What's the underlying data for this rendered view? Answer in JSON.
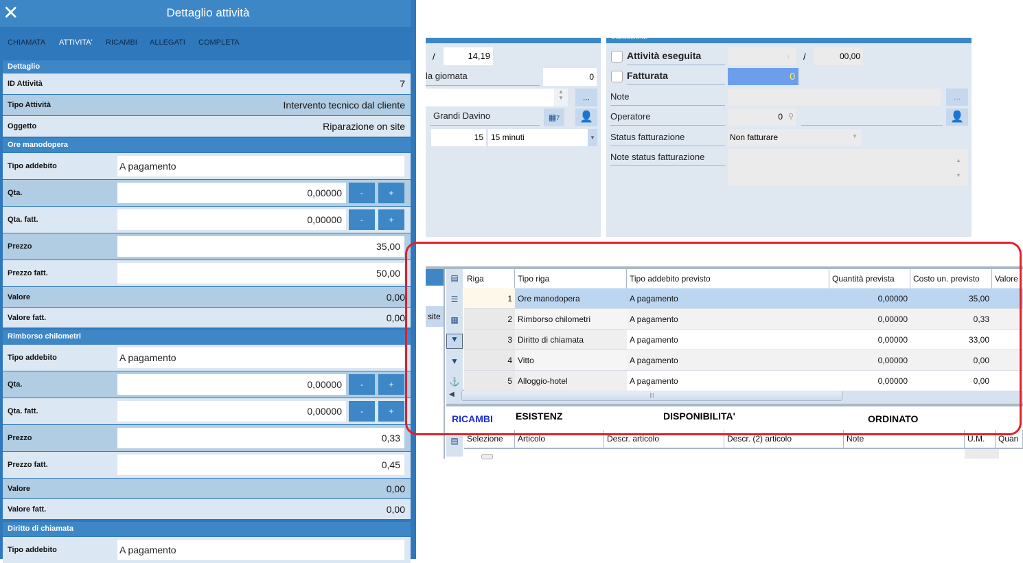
{
  "left": {
    "title": "Dettaglio attività",
    "close_icon": "close-icon",
    "tabs": [
      "CHIAMATA",
      "ATTIVITA'",
      "RICAMBI",
      "ALLEGATI",
      "COMPLETA"
    ],
    "active_tab": 1,
    "dettaglio": {
      "title": "Dettaglio",
      "rows": [
        [
          "ID Attività",
          "7"
        ],
        [
          "Tipo Attività",
          "Intervento tecnico dal cliente"
        ],
        [
          "Oggetto",
          "Riparazione on site"
        ]
      ]
    },
    "sections": [
      {
        "title": "Ore manodopera",
        "tipo_label": "Tipo addebito",
        "tipo": "A pagamento",
        "qta_label": "Qta.",
        "qta": "0,00000",
        "qta_fatt_label": "Qta. fatt.",
        "qta_fatt": "0,00000",
        "prezzo_label": "Prezzo",
        "prezzo": "35,00",
        "prezzo_fatt_label": "Prezzo fatt.",
        "prezzo_fatt": "50,00",
        "valore_label": "Valore",
        "valore": "0,00",
        "valore_fatt_label": "Valore fatt.",
        "valore_fatt": "0,00"
      },
      {
        "title": "Rimborso chilometri",
        "tipo_label": "Tipo addebito",
        "tipo": "A pagamento",
        "qta_label": "Qta.",
        "qta": "0,00000",
        "qta_fatt_label": "Qta. fatt.",
        "qta_fatt": "0,00000",
        "prezzo_label": "Prezzo",
        "prezzo": "0,33",
        "prezzo_fatt_label": "Prezzo fatt.",
        "prezzo_fatt": "0,45",
        "valore_label": "Valore",
        "valore": "0,00",
        "valore_fatt_label": "Valore fatt.",
        "valore_fatt": "0,00"
      },
      {
        "title": "Diritto di chiamata",
        "tipo_label": "Tipo addebito",
        "tipo": "A pagamento"
      }
    ],
    "minus": "-",
    "plus": "+"
  },
  "panel1": {
    "slash": "/",
    "time": "14,19",
    "giornata_label": "la giornata",
    "giornata": "0",
    "dots": "...",
    "operator": "Grandi Davino",
    "calendar_num": "7",
    "minutes": "15",
    "minutes_select": "15 minuti"
  },
  "panel2": {
    "header": "ESECUZIONE",
    "eseguita_label": "Attività eseguita",
    "slash": "/",
    "time": "00,00",
    "fatturata_label": "Fatturata",
    "fatturata_value": "0",
    "note_label": "Note",
    "dots": "...",
    "operatore_label": "Operatore",
    "operatore_value": "0",
    "status_label": "Status fatturazione",
    "status_value": "Non fatturare",
    "note_status_label": "Note status fatturazione"
  },
  "grid": {
    "side_text": "site",
    "columns": [
      "Riga",
      "Tipo riga",
      "Tipo addebito previsto",
      "Quantità prevista",
      "Costo un. previsto",
      "Valore"
    ],
    "rows": [
      [
        "1",
        "Ore manodopera",
        "A pagamento",
        "0,00000",
        "35,00"
      ],
      [
        "2",
        "Rimborso chilometri",
        "A pagamento",
        "0,00000",
        "0,33"
      ],
      [
        "3",
        "Diritto di chiamata",
        "A pagamento",
        "0,00000",
        "33,00"
      ],
      [
        "4",
        "Vitto",
        "A pagamento",
        "0,00000",
        "0,00"
      ],
      [
        "5",
        "Alloggio-hotel",
        "A pagamento",
        "0,00000",
        "0,00"
      ]
    ],
    "scroll_grip": "|||"
  },
  "ricambi": {
    "title": "RICAMBI",
    "esistenz": "ESISTENZ",
    "disponibilita": "DISPONIBILITA'",
    "ordinato": "ORDINATO",
    "columns": [
      "Selezione",
      "Articolo",
      "Descr. articolo",
      "Descr. (2) articolo",
      "Note",
      "U.M.",
      "Quan"
    ]
  },
  "colors": {
    "header": "#3d87c7",
    "tabs_bg": "#2f78bb",
    "highlight": "#6d9eeb",
    "annotation": "#e0202a"
  }
}
